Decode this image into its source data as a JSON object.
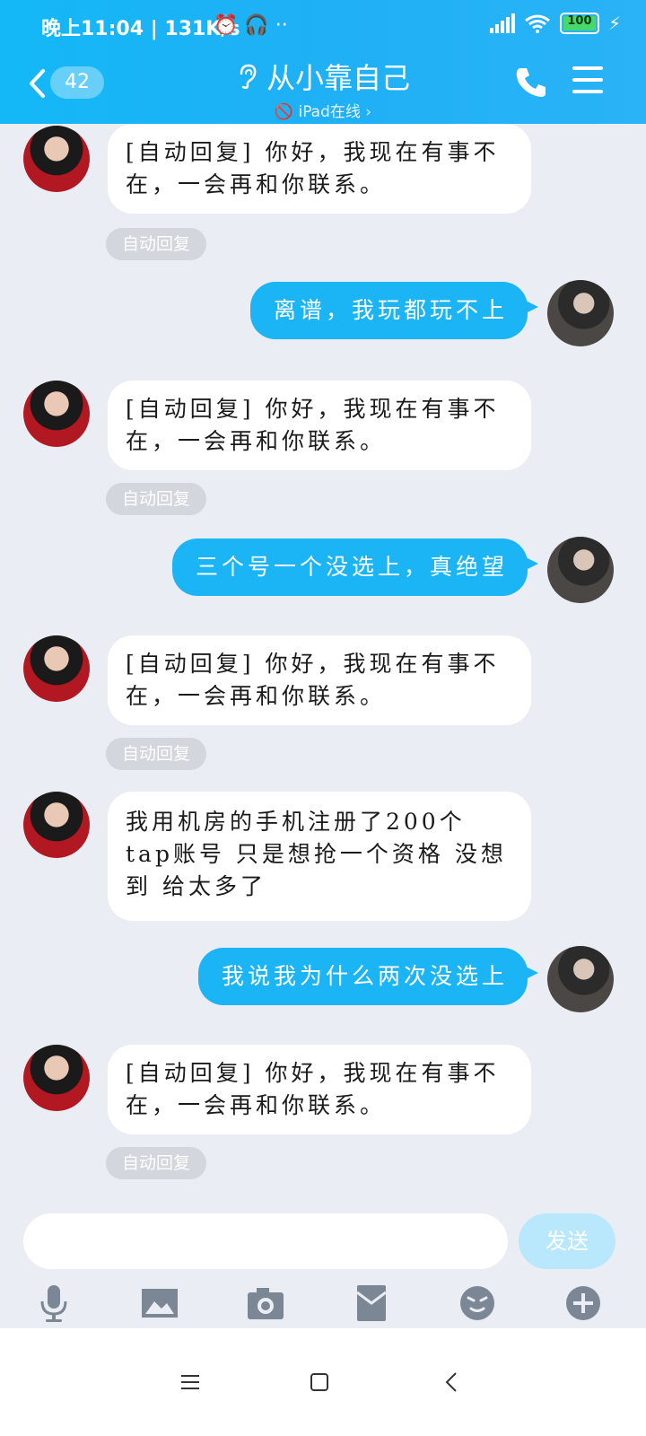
{
  "status": {
    "time": "晚上11:04 | 131K/s",
    "battery": "100"
  },
  "header": {
    "back_count": "42",
    "title": "从小靠自己",
    "subtitle_icon": "🚫",
    "subtitle": "iPad在线",
    "subtitle_chevron": "›"
  },
  "messages": [
    {
      "side": "in",
      "text": "[自动回复] 你好，我现在有事不在，一会再和你联系。",
      "tag": "自动回复"
    },
    {
      "side": "out",
      "text": "离谱，我玩都玩不上"
    },
    {
      "side": "in",
      "text": "[自动回复] 你好，我现在有事不在，一会再和你联系。",
      "tag": "自动回复"
    },
    {
      "side": "out",
      "text": "三个号一个没选上，真绝望"
    },
    {
      "side": "in",
      "text": "[自动回复] 你好，我现在有事不在，一会再和你联系。",
      "tag": "自动回复"
    },
    {
      "side": "in",
      "text": "我用机房的手机注册了200个tap账号 只是想抢一个资格 没想到 给太多了"
    },
    {
      "side": "out",
      "text": "我说我为什么两次没选上"
    },
    {
      "side": "in",
      "text": "[自动回复] 你好，我现在有事不在，一会再和你联系。",
      "tag": "自动回复"
    }
  ],
  "input": {
    "placeholder": "",
    "send_label": "发送"
  },
  "toolbar": {
    "icons": [
      "microphone-icon",
      "image-icon",
      "camera-icon",
      "red-packet-icon",
      "emoji-icon",
      "plus-icon"
    ]
  },
  "navbar": {
    "icons": [
      "menu-icon",
      "home-icon",
      "back-icon"
    ]
  },
  "colors": {
    "header": "#1fb0f5",
    "out_bubble": "#1bb5f6",
    "in_bubble": "#ffffff",
    "background": "#eaedf4"
  }
}
